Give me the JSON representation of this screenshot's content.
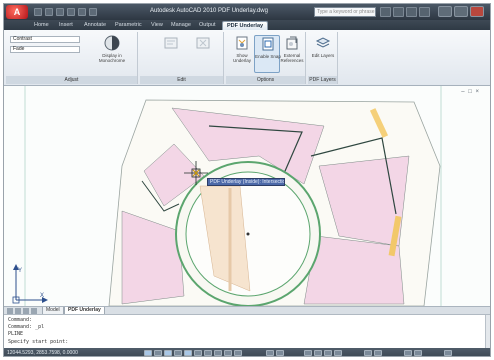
{
  "titlebar": {
    "app_logo": "A",
    "title": "Autodesk AutoCAD 2010    PDF Underlay.dwg",
    "search_placeholder": "Type a keyword or phrase",
    "icons": [
      "new-icon",
      "open-icon",
      "save-icon",
      "undo-icon",
      "redo-icon",
      "plot-icon"
    ]
  },
  "tabs": [
    "Home",
    "Insert",
    "Annotate",
    "Parametric",
    "View",
    "Manage",
    "Output",
    "PDF Underlay"
  ],
  "ribbon": {
    "adjust_panel": {
      "title": "Adjust",
      "contrast_label": "Contrast",
      "fade_label": "Fade",
      "monochrome_label": "Display in Monochrome"
    },
    "edit_panel": {
      "title": "Edit",
      "buttons": [
        "",
        ""
      ]
    },
    "options_panel": {
      "title": "Options",
      "buttons": [
        "Show Underlay",
        "Enable Snap",
        "External References"
      ]
    },
    "layers_panel": {
      "title": "PDF Layers",
      "button": "Edit Layers"
    }
  },
  "drawing": {
    "tooltip": "PDF Underlay (Inside): Intersection",
    "viewport_controls": "– □ ×",
    "ucs_x": "X",
    "ucs_y": "Y"
  },
  "layout_tabs": [
    "Model",
    "PDF Underlay"
  ],
  "command_lines": [
    "Command:",
    "Command: _pl",
    "PLINE",
    "Specify start point:"
  ],
  "statusbar": {
    "coords": "12044.5293, 2853.7598, 0.0000"
  },
  "colors": {
    "frame_dark": "#3a4552",
    "pink_room": "#f3d6e6",
    "green_line": "#6fb07c",
    "dark_outline": "#2f4740",
    "tooltip_bg": "#4c69a8"
  }
}
